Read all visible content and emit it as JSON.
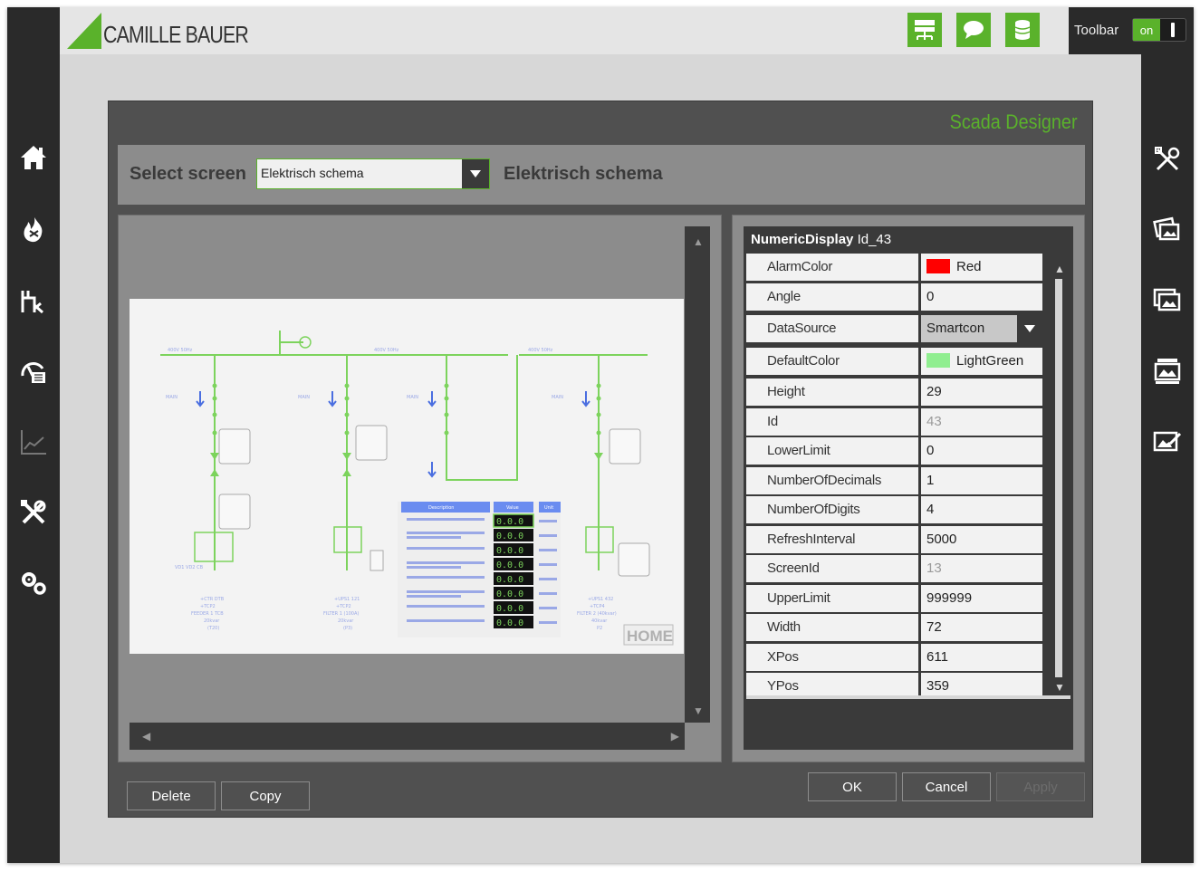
{
  "header": {
    "brand": "CAMILLE BAUER",
    "toolbar_label": "Toolbar",
    "toggle_label": "on"
  },
  "left_nav": [
    "home-icon",
    "fire-icon",
    "factory-icon",
    "gauge-icon",
    "chart-icon",
    "tools-icon",
    "settings-icon"
  ],
  "right_nav": [
    "tools-icon",
    "images-icon",
    "image-icon",
    "image-stack-icon",
    "image-edit-icon"
  ],
  "dialog": {
    "title": "Scada Designer",
    "select_label": "Select screen",
    "select_value": "Elektrisch schema",
    "screen_title": "Elektrisch schema"
  },
  "schema": {
    "home_label": "HOME",
    "table_headers": [
      "Description",
      "Value",
      "Unit"
    ],
    "meter_value": "0.0.0"
  },
  "properties": {
    "type": "NumericDisplay",
    "id_label": "Id_43",
    "rows": [
      {
        "name": "AlarmColor",
        "value": "Red",
        "color": "#ff0000"
      },
      {
        "name": "Angle",
        "value": "0"
      },
      {
        "name": "DataSource",
        "value": "Smartcon"
      },
      {
        "name": "DefaultColor",
        "value": "LightGreen",
        "color": "#90ee90"
      },
      {
        "name": "Height",
        "value": "29"
      },
      {
        "name": "Id",
        "value": "43"
      },
      {
        "name": "LowerLimit",
        "value": "0"
      },
      {
        "name": "NumberOfDecimals",
        "value": "1"
      },
      {
        "name": "NumberOfDigits",
        "value": "4"
      },
      {
        "name": "RefreshInterval",
        "value": "5000"
      },
      {
        "name": "ScreenId",
        "value": "13"
      },
      {
        "name": "UpperLimit",
        "value": "999999"
      },
      {
        "name": "Width",
        "value": "72"
      },
      {
        "name": "XPos",
        "value": "611"
      },
      {
        "name": "YPos",
        "value": "359"
      }
    ]
  },
  "buttons": {
    "delete": "Delete",
    "copy": "Copy",
    "ok": "OK",
    "cancel": "Cancel",
    "apply": "Apply"
  },
  "colors": {
    "accent_green": "#5ab22b",
    "dark": "#2a2a2a",
    "schema_line": "#7cd35c",
    "schema_blue": "#4a6ee0"
  }
}
